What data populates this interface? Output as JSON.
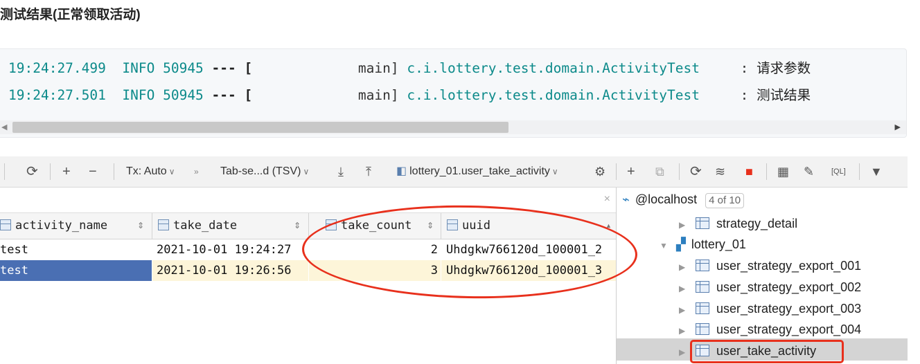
{
  "heading": "测试结果(正常领取活动)",
  "log": {
    "lines": [
      {
        "time": "19:24:27.499",
        "level": "INFO",
        "pid": "50945",
        "sep": "--- [",
        "thread": "main]",
        "logger": "c.i.lottery.test.domain.ActivityTest",
        "colon": ":",
        "message": "请求参数"
      },
      {
        "time": "19:24:27.501",
        "level": "INFO",
        "pid": "50945",
        "sep": "--- [",
        "thread": "main]",
        "logger": "c.i.lottery.test.domain.ActivityTest",
        "colon": ":",
        "message": "测试结果"
      }
    ]
  },
  "toolbar": {
    "tx_label": "Tx: Auto",
    "format_label": "Tab-se...d (TSV)",
    "table_label": "lottery_01.user_take_activity"
  },
  "grid": {
    "columns": [
      "activity_name",
      "take_date",
      "take_count",
      "uuid"
    ],
    "rows": [
      [
        "test",
        "2021-10-01 19:24:27",
        "2",
        "Uhdgkw766120d_100001_2"
      ],
      [
        "test",
        "2021-10-01 19:26:56",
        "3",
        "Uhdgkw766120d_100001_3"
      ]
    ]
  },
  "tree": {
    "host": "@localhost",
    "host_badge": "4 of 10",
    "items": [
      {
        "label": "strategy_detail",
        "kind": "table"
      },
      {
        "label": "lottery_01",
        "kind": "schema"
      },
      {
        "label": "user_strategy_export_001",
        "kind": "table"
      },
      {
        "label": "user_strategy_export_002",
        "kind": "table"
      },
      {
        "label": "user_strategy_export_003",
        "kind": "table"
      },
      {
        "label": "user_strategy_export_004",
        "kind": "table"
      },
      {
        "label": "user_take_activity",
        "kind": "table",
        "selected": true
      }
    ]
  },
  "colors": {
    "accent_red": "#e8301c",
    "selection_blue": "#4a6fb3",
    "log_teal": "#0c8a8a"
  },
  "icons": [
    "refresh-icon",
    "add-icon",
    "remove-icon",
    "download-icon",
    "upload-icon",
    "settings-icon",
    "filter-icon",
    "database-icon",
    "table-icon"
  ]
}
